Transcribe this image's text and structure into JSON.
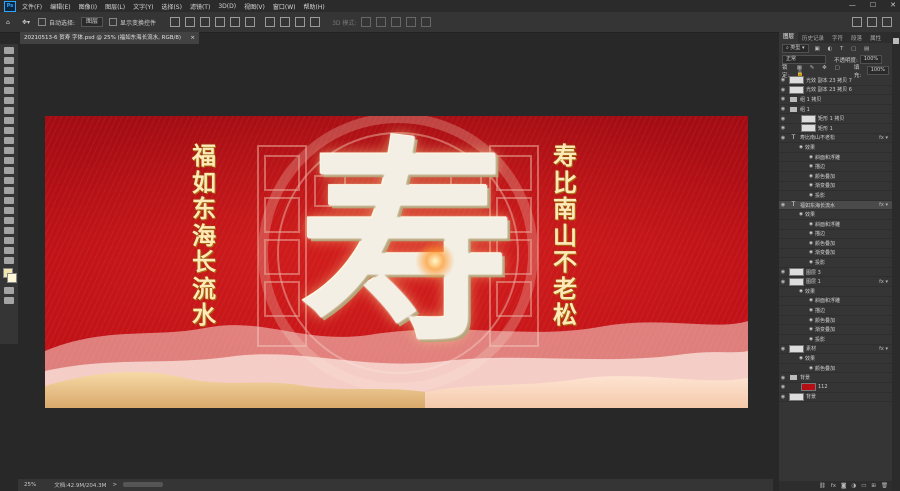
{
  "menu": {
    "app_icon": "Ps",
    "items": [
      "文件(F)",
      "编辑(E)",
      "图像(I)",
      "图层(L)",
      "文字(Y)",
      "选择(S)",
      "滤镜(T)",
      "3D(D)",
      "视图(V)",
      "窗口(W)",
      "帮助(H)"
    ],
    "window_controls": [
      "—",
      "☐",
      "✕"
    ]
  },
  "options": {
    "auto_select_label": "自动选择:",
    "auto_select_value": "图层",
    "show_transform_label": "显示变换控件",
    "mode_3d_label": "3D 模式:"
  },
  "document": {
    "tab_title": "20210513-6 贺寿 字体.psd @ 25% (福如东海长流水, RGB/8)",
    "close": "×",
    "left_text": "福如东海长流水",
    "right_text": "寿比南山不老松",
    "big_glyph": "寿"
  },
  "status": {
    "zoom": "25%",
    "doc_info": "文档:42.9M/204.3M",
    "arrow": ">"
  },
  "panel": {
    "tabs": [
      "图层",
      "历史记录",
      "字符",
      "段落",
      "属性"
    ],
    "active_tab": 0,
    "filter_label": "类型",
    "blend_mode": "正常",
    "opacity_label": "不透明度:",
    "opacity_value": "100%",
    "lock_label": "锁定:",
    "fill_label": "填充:",
    "fill_value": "100%",
    "layers": [
      {
        "name": "光效 副本 23 拷贝 7",
        "kind": "img",
        "indent": 0,
        "fx": false,
        "sel": false
      },
      {
        "name": "光效 副本 23 拷贝 6",
        "kind": "img",
        "indent": 0,
        "fx": false,
        "sel": false
      },
      {
        "name": "组 1 拷贝",
        "kind": "folder",
        "indent": 0,
        "fx": false,
        "sel": false
      },
      {
        "name": "组 1",
        "kind": "folder",
        "indent": 0,
        "fx": false,
        "sel": false
      },
      {
        "name": "矩形 1 拷贝",
        "kind": "img",
        "indent": 1,
        "fx": false,
        "sel": false
      },
      {
        "name": "矩形 1",
        "kind": "img",
        "indent": 1,
        "fx": false,
        "sel": false
      },
      {
        "name": "寿比南山不老松",
        "kind": "text",
        "indent": 0,
        "fx": true,
        "sel": false
      },
      {
        "name": "效果",
        "kind": "fxhead",
        "indent": 1,
        "fx": false,
        "sel": false
      },
      {
        "name": "斜面和浮雕",
        "kind": "fxitem",
        "indent": 2,
        "fx": false,
        "sel": false
      },
      {
        "name": "描边",
        "kind": "fxitem",
        "indent": 2,
        "fx": false,
        "sel": false
      },
      {
        "name": "颜色叠加",
        "kind": "fxitem",
        "indent": 2,
        "fx": false,
        "sel": false
      },
      {
        "name": "渐变叠加",
        "kind": "fxitem",
        "indent": 2,
        "fx": false,
        "sel": false
      },
      {
        "name": "投影",
        "kind": "fxitem",
        "indent": 2,
        "fx": false,
        "sel": false
      },
      {
        "name": "福如东海长流水",
        "kind": "text",
        "indent": 0,
        "fx": true,
        "sel": true
      },
      {
        "name": "效果",
        "kind": "fxhead",
        "indent": 1,
        "fx": false,
        "sel": false
      },
      {
        "name": "斜面和浮雕",
        "kind": "fxitem",
        "indent": 2,
        "fx": false,
        "sel": false
      },
      {
        "name": "描边",
        "kind": "fxitem",
        "indent": 2,
        "fx": false,
        "sel": false
      },
      {
        "name": "颜色叠加",
        "kind": "fxitem",
        "indent": 2,
        "fx": false,
        "sel": false
      },
      {
        "name": "渐变叠加",
        "kind": "fxitem",
        "indent": 2,
        "fx": false,
        "sel": false
      },
      {
        "name": "投影",
        "kind": "fxitem",
        "indent": 2,
        "fx": false,
        "sel": false
      },
      {
        "name": "图层 3",
        "kind": "img",
        "indent": 0,
        "fx": false,
        "sel": false
      },
      {
        "name": "图层 1",
        "kind": "img",
        "indent": 0,
        "fx": true,
        "sel": false
      },
      {
        "name": "效果",
        "kind": "fxhead",
        "indent": 1,
        "fx": false,
        "sel": false
      },
      {
        "name": "斜面和浮雕",
        "kind": "fxitem",
        "indent": 2,
        "fx": false,
        "sel": false
      },
      {
        "name": "描边",
        "kind": "fxitem",
        "indent": 2,
        "fx": false,
        "sel": false
      },
      {
        "name": "颜色叠加",
        "kind": "fxitem",
        "indent": 2,
        "fx": false,
        "sel": false
      },
      {
        "name": "渐变叠加",
        "kind": "fxitem",
        "indent": 2,
        "fx": false,
        "sel": false
      },
      {
        "name": "投影",
        "kind": "fxitem",
        "indent": 2,
        "fx": false,
        "sel": false
      },
      {
        "name": "素材",
        "kind": "img",
        "indent": 0,
        "fx": true,
        "sel": false
      },
      {
        "name": "效果",
        "kind": "fxhead",
        "indent": 1,
        "fx": false,
        "sel": false
      },
      {
        "name": "颜色叠加",
        "kind": "fxitem",
        "indent": 2,
        "fx": false,
        "sel": false
      },
      {
        "name": "背景",
        "kind": "folder",
        "indent": 0,
        "fx": false,
        "sel": false
      },
      {
        "name": "112",
        "kind": "red",
        "indent": 1,
        "fx": false,
        "sel": false
      },
      {
        "name": "背景",
        "kind": "img",
        "indent": 0,
        "fx": false,
        "sel": false
      }
    ]
  },
  "colors": {
    "accent": "#31a8ff",
    "poster_red": "#b50f15",
    "gold_text": "#ffe9b8"
  }
}
